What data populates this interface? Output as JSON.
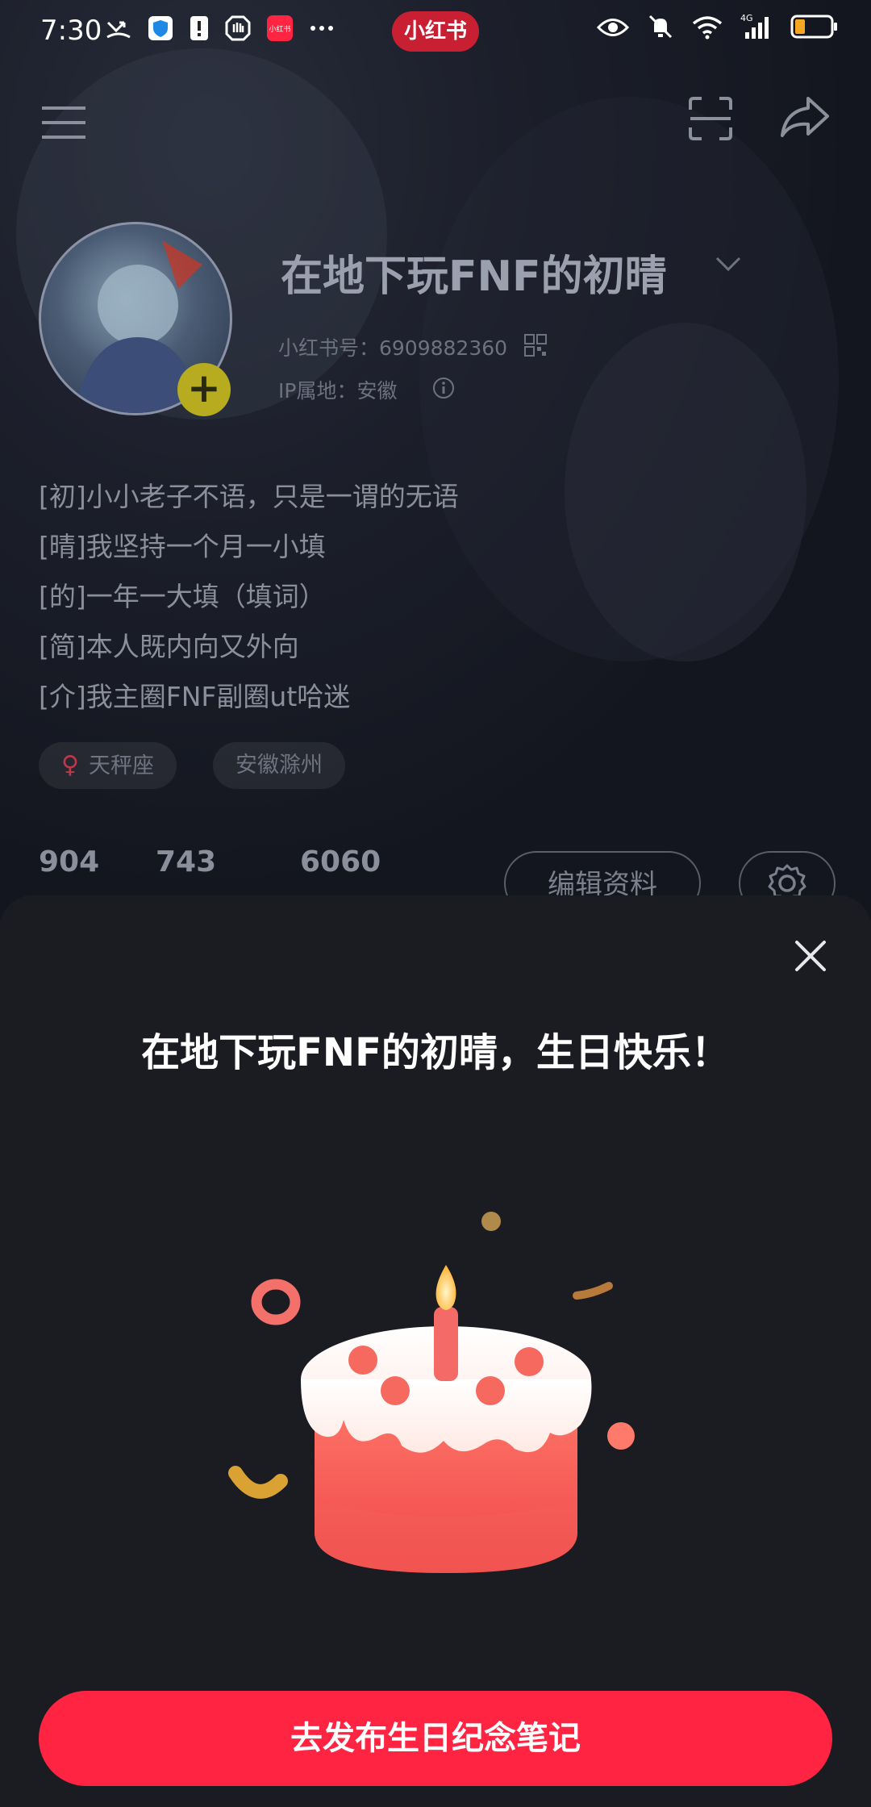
{
  "status_bar": {
    "time": "7:30",
    "app_pill": "小红书",
    "network": "4G"
  },
  "header": {
    "menu_icon": "hamburger-icon",
    "scan_icon": "scan-icon",
    "share_icon": "share-icon"
  },
  "profile": {
    "username": "在地下玩FNF的初晴",
    "id_line": "小红书号：6909882360",
    "ip_line": "IP属地：安徽",
    "bio": [
      "[初]小小老子不语，只是一谓的无语",
      "[晴]我坚持一个月一小填",
      "[的]一年一大填（填词）",
      "[简]本人既内向又外向",
      "[介]我主圈FNF副圈ut哈迷"
    ],
    "tags": [
      {
        "icon": "female-icon",
        "label": "天秤座"
      },
      {
        "label": "安徽滁州"
      }
    ],
    "stats": [
      "904",
      "743",
      "6060"
    ],
    "edit_label": "编辑资料"
  },
  "sheet": {
    "greeting": "在地下玩FNF的初晴，生日快乐！",
    "publish_label": "去发布生日纪念笔记"
  },
  "colors": {
    "accent": "#ff2442",
    "sheet_bg": "#1b1b22"
  }
}
